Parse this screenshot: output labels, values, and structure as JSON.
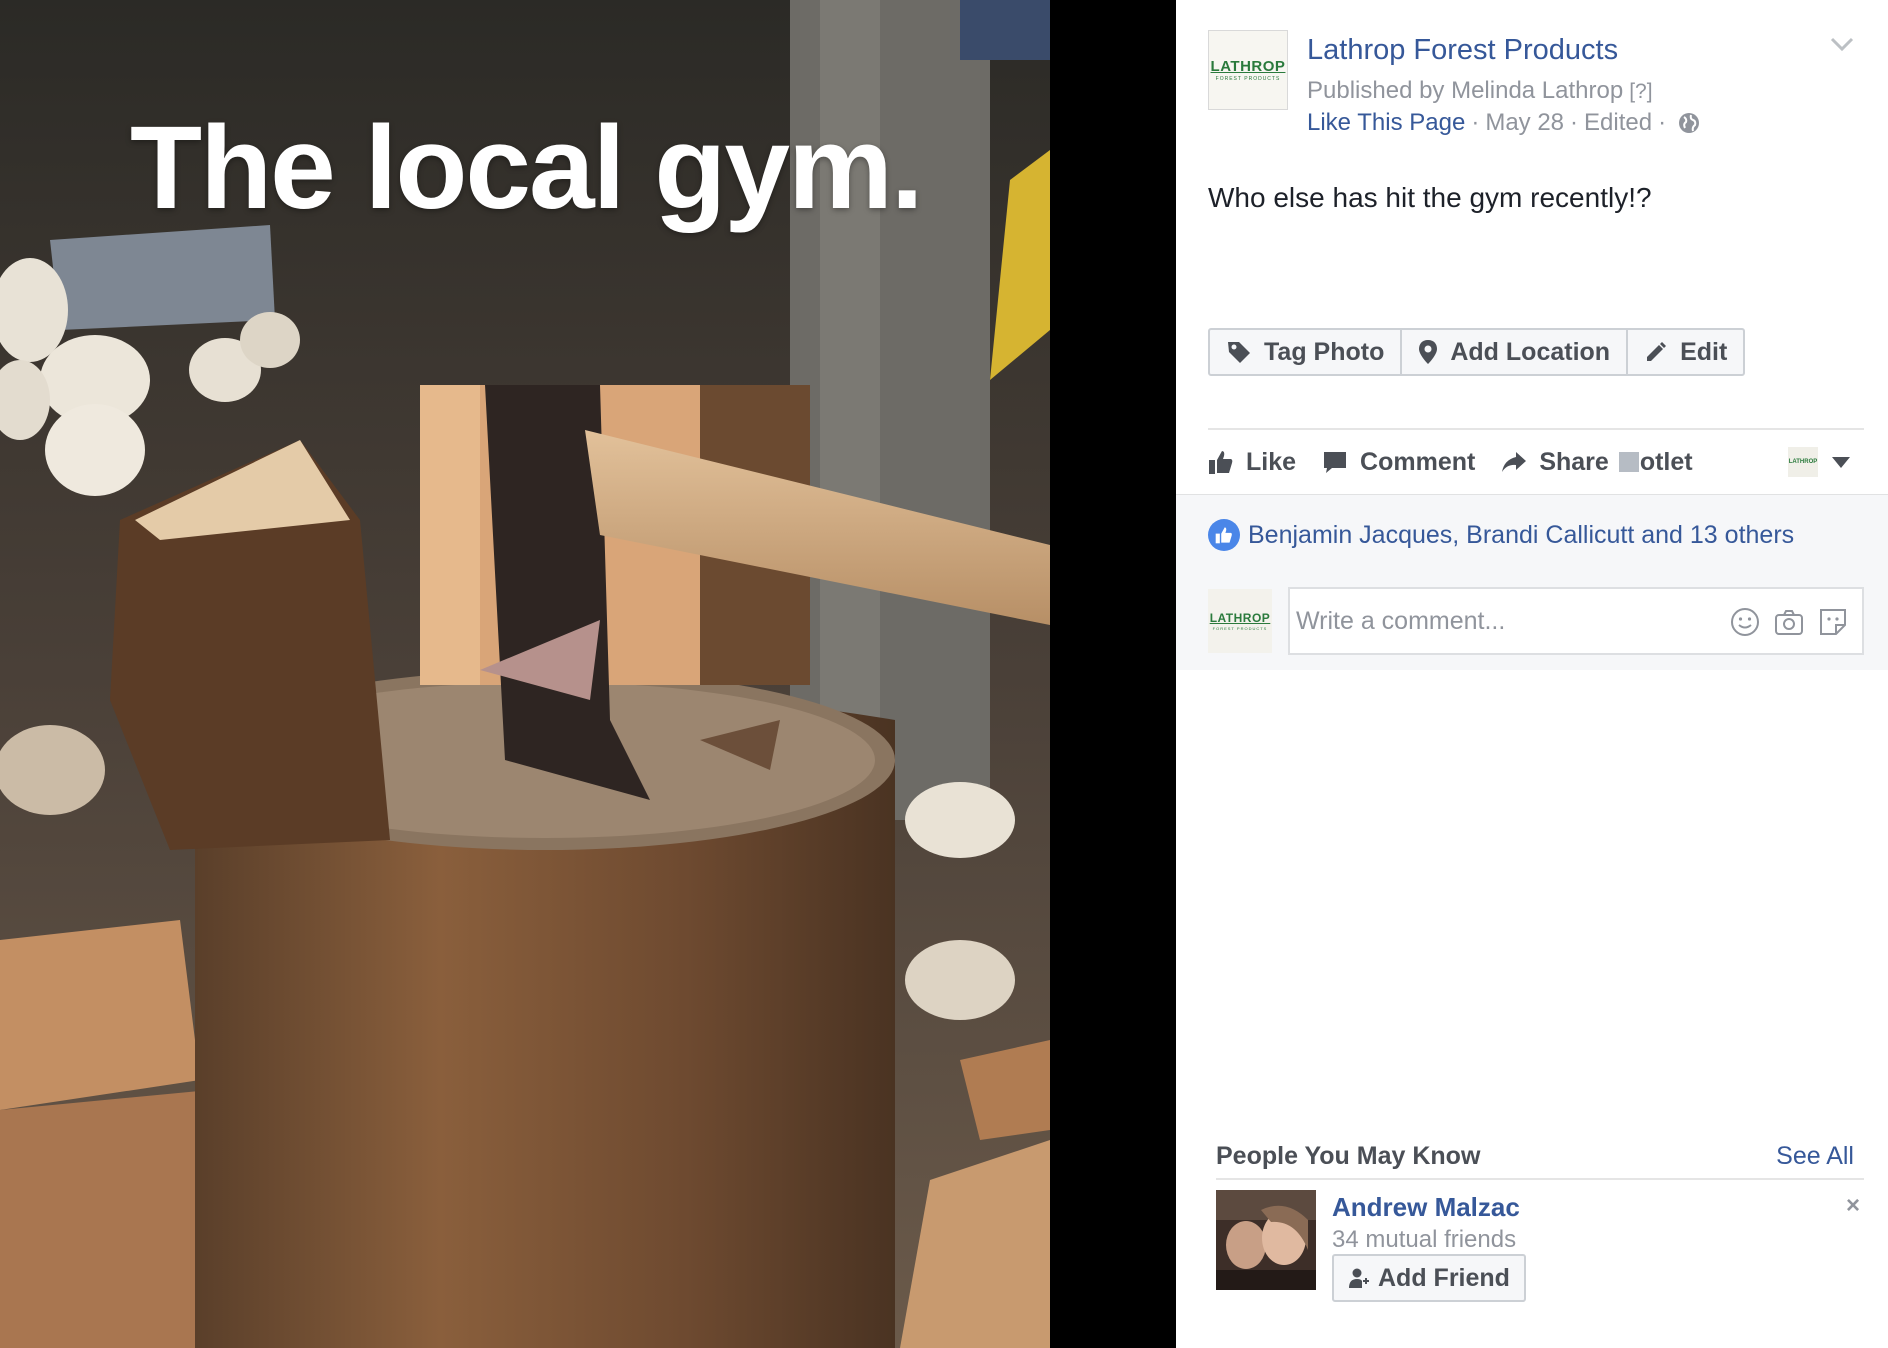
{
  "photo": {
    "caption": "The local gym."
  },
  "post": {
    "page_name": "Lathrop Forest Products",
    "page_logo": {
      "word": "LATHROP",
      "sub": "FOREST PRODUCTS"
    },
    "published_by": "Published by Melinda Lathrop",
    "help_marker": "[?]",
    "like_page": "Like This Page",
    "date": "May 28",
    "edited": "Edited",
    "status_text": "Who else has hit the gym recently!?",
    "buttons": {
      "tag_photo": "Tag Photo",
      "add_location": "Add Location",
      "edit": "Edit"
    },
    "actions": {
      "like": "Like",
      "comment": "Comment",
      "share": "Share",
      "hootlet": "otlet"
    }
  },
  "feedback": {
    "likes_text": "Benjamin Jacques, Brandi Callicutt and 13 others",
    "comment_placeholder": "Write a comment..."
  },
  "pymk": {
    "title": "People You May Know",
    "see_all": "See All",
    "person": {
      "name": "Andrew Malzac",
      "mutual": "34 mutual friends",
      "add_friend": "Add Friend",
      "close": "×"
    }
  },
  "colors": {
    "link_blue": "#365899",
    "text_dark": "#1d2129",
    "text_grey": "#90949c",
    "button_text": "#4b4f56",
    "logo_green": "#2a7a3c"
  }
}
